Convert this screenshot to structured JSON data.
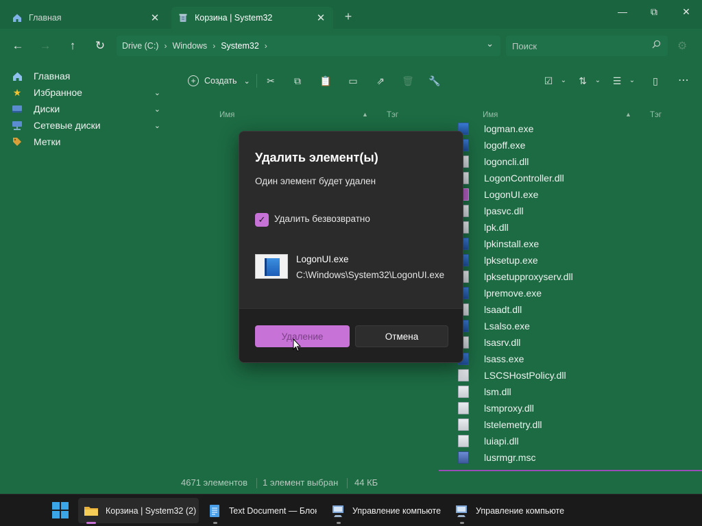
{
  "tabs": [
    {
      "label": "Главная",
      "icon": "home-icon"
    },
    {
      "label": "Корзина | System32",
      "icon": "recycle-bin-icon"
    }
  ],
  "window_controls": {
    "minimize": "—",
    "maximize": "⧉",
    "close": "✕"
  },
  "address": {
    "crumbs": [
      "Drive (C:)",
      "Windows",
      "System32"
    ],
    "search_placeholder": "Поиск"
  },
  "sidebar": {
    "items": [
      {
        "label": "Главная",
        "icon": "home-icon",
        "expandable": false
      },
      {
        "label": "Избранное",
        "icon": "star-icon",
        "expandable": true
      },
      {
        "label": "Диски",
        "icon": "drive-icon",
        "expandable": true
      },
      {
        "label": "Сетевые диски",
        "icon": "network-drive-icon",
        "expandable": true
      },
      {
        "label": "Метки",
        "icon": "tag-icon",
        "expandable": false
      }
    ]
  },
  "toolbar": {
    "create_label": "Создать"
  },
  "columns": {
    "left_name": "Имя",
    "left_tag": "Тэг",
    "right_name": "Имя",
    "right_tag": "Тэг"
  },
  "files": [
    {
      "name": "logman.exe",
      "type": "exe"
    },
    {
      "name": "logoff.exe",
      "type": "exe"
    },
    {
      "name": "logoncli.dll",
      "type": "dll"
    },
    {
      "name": "LogonController.dll",
      "type": "dll"
    },
    {
      "name": "LogonUI.exe",
      "type": "sel"
    },
    {
      "name": "lpasvc.dll",
      "type": "dll"
    },
    {
      "name": "lpk.dll",
      "type": "dll"
    },
    {
      "name": "lpkinstall.exe",
      "type": "exe"
    },
    {
      "name": "lpksetup.exe",
      "type": "exe"
    },
    {
      "name": "lpksetupproxyserv.dll",
      "type": "dll"
    },
    {
      "name": "lpremove.exe",
      "type": "exe"
    },
    {
      "name": "lsaadt.dll",
      "type": "dll"
    },
    {
      "name": "Lsalso.exe",
      "type": "exe"
    },
    {
      "name": "lsasrv.dll",
      "type": "dll"
    },
    {
      "name": "lsass.exe",
      "type": "exe"
    },
    {
      "name": "LSCSHostPolicy.dll",
      "type": "dll"
    },
    {
      "name": "lsm.dll",
      "type": "dll"
    },
    {
      "name": "lsmproxy.dll",
      "type": "dll"
    },
    {
      "name": "lstelemetry.dll",
      "type": "dll"
    },
    {
      "name": "luiapi.dll",
      "type": "dll"
    },
    {
      "name": "lusrmgr.msc",
      "type": "msc"
    }
  ],
  "status": {
    "count": "4671 элементов",
    "selected": "1 элемент выбран",
    "size": "44 КБ"
  },
  "dialog": {
    "title": "Удалить элемент(ы)",
    "message": "Один элемент будет удален",
    "checkbox_label": "Удалить безвозвратно",
    "checkbox_checked": true,
    "file_name": "LogonUI.exe",
    "file_path": "C:\\Windows\\System32\\LogonUI.exe",
    "delete_label": "Удаление",
    "cancel_label": "Отмена"
  },
  "taskbar": {
    "items": [
      {
        "label": "Корзина | System32 (2)",
        "icon": "folder-icon",
        "active": true
      },
      {
        "label": "Text Document — Блокнот",
        "icon": "notepad-icon",
        "active": false
      },
      {
        "label": "Управление компьюте",
        "icon": "computer-management-icon",
        "active": false
      },
      {
        "label": "Управление компьюте",
        "icon": "computer-management-icon",
        "active": false
      }
    ]
  },
  "colors": {
    "background": "#1c6b43",
    "accent": "#c772d6",
    "dialog": "#2b2b2b",
    "taskbar": "#1a1a1a"
  }
}
